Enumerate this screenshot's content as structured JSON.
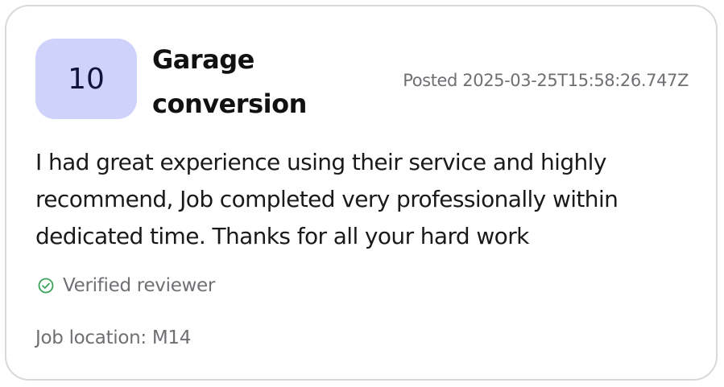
{
  "review": {
    "score": "10",
    "job_title": "Garage conversion",
    "posted": "Posted 2025-03-25T15:58:26.747Z",
    "text": "I had great experience using their service and highly recommend, Job completed very professionally within dedicated time. Thanks for all your hard work",
    "verified_label": "Verified reviewer",
    "location": "Job location: M14"
  },
  "icons": {
    "verified": "check-circle-icon"
  },
  "colors": {
    "score_badge_bg": "#cfd2fb",
    "verified_icon": "#3aa35a",
    "muted_text": "#6f6f74"
  }
}
